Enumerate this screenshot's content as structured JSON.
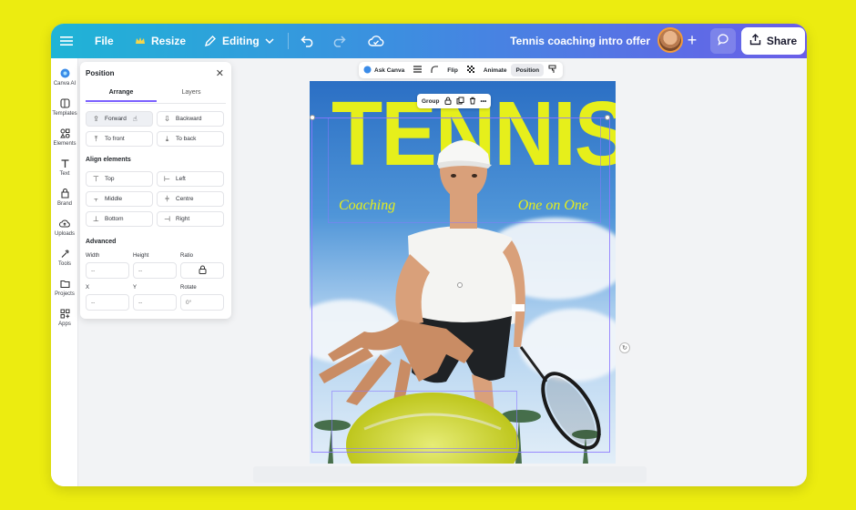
{
  "topbar": {
    "file_label": "File",
    "resize_label": "Resize",
    "editing_label": "Editing",
    "doc_title": "Tennis coaching intro offer",
    "share_label": "Share",
    "accent_start": "#1fb4d6",
    "accent_end": "#6a5ee8"
  },
  "rail": {
    "items": [
      {
        "label": "Canva AI",
        "icon": "canva-ai-icon"
      },
      {
        "label": "Templates",
        "icon": "templates-icon"
      },
      {
        "label": "Elements",
        "icon": "elements-icon"
      },
      {
        "label": "Text",
        "icon": "text-icon"
      },
      {
        "label": "Brand",
        "icon": "brand-icon"
      },
      {
        "label": "Uploads",
        "icon": "uploads-icon"
      },
      {
        "label": "Tools",
        "icon": "tools-icon"
      },
      {
        "label": "Projects",
        "icon": "projects-icon"
      },
      {
        "label": "Apps",
        "icon": "apps-icon"
      }
    ]
  },
  "panel": {
    "title": "Position",
    "tabs": [
      "Arrange",
      "Layers"
    ],
    "arrange": {
      "forward": "Forward",
      "backward": "Backward",
      "to_front": "To front",
      "to_back": "To back"
    },
    "align_title": "Align elements",
    "align": {
      "top": "Top",
      "left": "Left",
      "middle": "Middle",
      "centre": "Centre",
      "bottom": "Bottom",
      "right": "Right"
    },
    "advanced_title": "Advanced",
    "fields": {
      "width_label": "Width",
      "height_label": "Height",
      "ratio_label": "Ratio",
      "x_label": "X",
      "y_label": "Y",
      "rotate_label": "Rotate",
      "width_value": "--",
      "height_value": "--",
      "x_value": "--",
      "y_value": "--",
      "rotate_value": "0°"
    }
  },
  "canvas_toolbar": {
    "ask_canva": "Ask Canva",
    "flip": "Flip",
    "animate": "Animate",
    "position": "Position"
  },
  "design": {
    "headline": "TENNIS",
    "left_script": "Coaching",
    "right_script": "One on One",
    "headline_color": "#e6ef1b",
    "group_label": "Group"
  }
}
